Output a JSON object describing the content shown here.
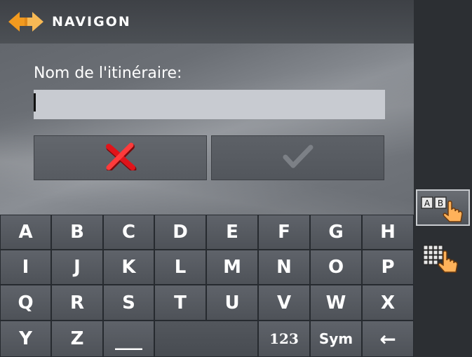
{
  "header": {
    "brand": "NAVIGON",
    "logo_icon": "navigon-arrows-logo-icon"
  },
  "form": {
    "label": "Nom de l'itinéraire:",
    "value": "",
    "placeholder": ""
  },
  "actions": {
    "cancel_icon": "red-x-cancel-icon",
    "confirm_icon": "checkmark-confirm-icon",
    "confirm_enabled": false
  },
  "keyboard": {
    "rows": [
      [
        "A",
        "B",
        "C",
        "D",
        "E",
        "F",
        "G",
        "H"
      ],
      [
        "I",
        "J",
        "K",
        "L",
        "M",
        "N",
        "O",
        "P"
      ],
      [
        "Q",
        "R",
        "S",
        "T",
        "U",
        "V",
        "W",
        "X"
      ],
      [
        "Y",
        "Z"
      ]
    ],
    "space_label": "___",
    "numbers_label": "123",
    "symbols_label": "Sym",
    "backspace_label": "←"
  },
  "sidebar": {
    "abc_mode_icon": "ab-keyboard-hand-icon",
    "grid_mode_icon": "grid-keyboard-hand-icon",
    "active_mode": "abc"
  },
  "colors": {
    "cancel": "#e0141a",
    "logo_orange": "#f29a1f",
    "confirm_disabled": "#7c8086",
    "input_bg": "#c8cbd1"
  }
}
